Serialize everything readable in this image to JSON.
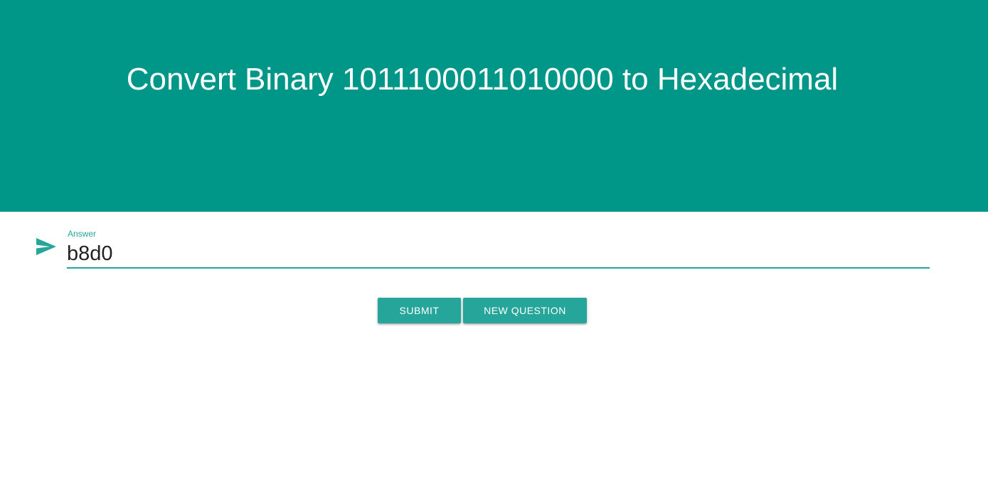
{
  "header": {
    "title": "Convert Binary 1011100011010000 to Hexadecimal",
    "background_color": "#009688"
  },
  "answer": {
    "icon": "send-icon",
    "label": "Answer",
    "value": "b8d0",
    "accent_color": "#26a69a"
  },
  "actions": {
    "submit_label": "SUBMIT",
    "new_question_label": "NEW QUESTION",
    "button_color": "#26a69a"
  }
}
